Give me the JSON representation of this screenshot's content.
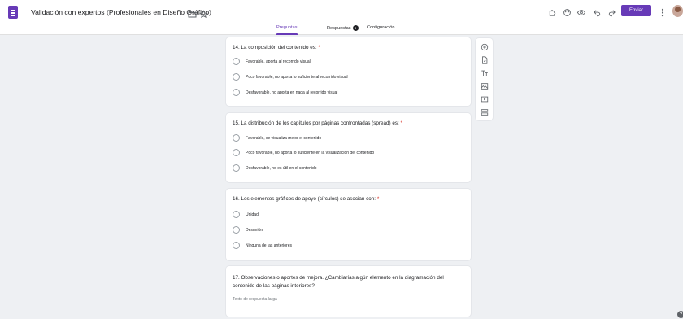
{
  "header": {
    "doc_title": "Validación con expertos (Profesionales en Diseño Gráfico)",
    "send_label": "Enviar",
    "icons": [
      "forms-logo-icon",
      "folder-icon",
      "star-icon",
      "addon-icon",
      "palette-icon",
      "preview-icon",
      "undo-icon",
      "redo-icon",
      "more-vert-icon"
    ]
  },
  "tabs": {
    "questions": "Preguntas",
    "responses": "Respuestas",
    "responses_count": "5",
    "settings": "Configuración"
  },
  "questions": [
    {
      "title": "14. La composición del contenido es:",
      "required_mark": "*",
      "options": [
        "Favorable, aporta al recorrido visual",
        "Poco favorable, no aporta lo suficiente al recorrido visual",
        "Desfavorable, no aporta en nada al recorrido visual"
      ]
    },
    {
      "title": "15. La distribución de los capítulos por páginas confrontadas (spread) es:",
      "required_mark": "*",
      "options": [
        "Favorable, se visualiza mejor el contenido",
        "Poco favorable, no aporta lo suficiente en la visualización del contenido",
        "Desfavorable, no es útil en el contenido"
      ]
    },
    {
      "title": "16. Los elementos gráficos de apoyo (círculos) se asocian con:",
      "required_mark": "*",
      "options": [
        "Unidad",
        "Desunión",
        "Ninguna de las anteriores"
      ]
    }
  ],
  "q17": {
    "title": "17. Observaciones o aportes de mejora. ¿Cambiarías algún elemento en la diagramación del contenido de las páginas interiores?",
    "placeholder": "Texto de respuesta larga"
  },
  "toolbar": [
    "add-question-icon",
    "import-questions-icon",
    "add-title-icon",
    "add-image-icon",
    "add-video-icon",
    "add-section-icon"
  ],
  "help_label": "?"
}
